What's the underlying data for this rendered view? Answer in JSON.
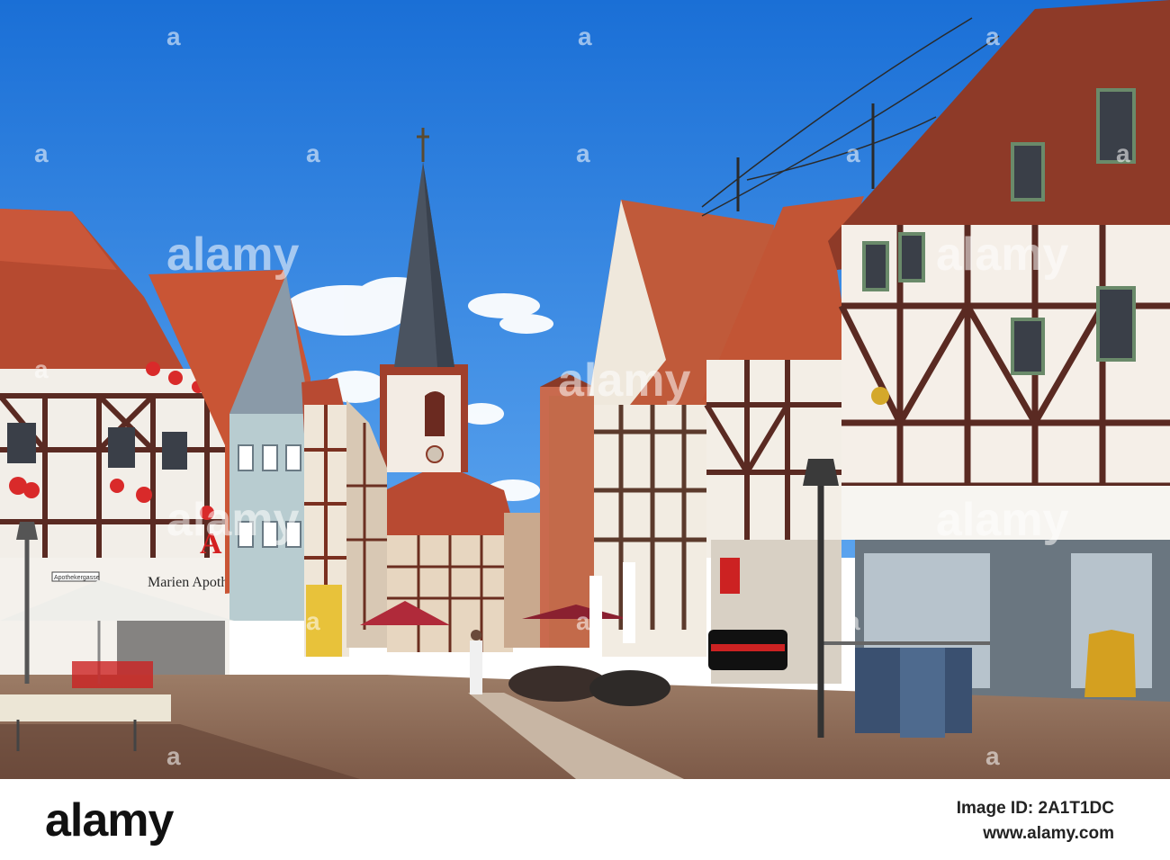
{
  "photo": {
    "subject": "Half-timbered houses on a cobblestone old-town street with a church spire",
    "sky_color": "#2f7fd8",
    "accent_timber": "#5a2a22",
    "roof_color": "#b8472c",
    "cobble_color": "#8a6652"
  },
  "shop_signs": {
    "pharmacy": "Marien Apotheke",
    "street_sign": "Apothekergasse",
    "pharmacy_symbol": "A"
  },
  "watermark": {
    "brand": "alamy",
    "image_id": "Image ID: 2A1T1DC",
    "site": "www.alamy.com",
    "tile_text": "a"
  }
}
